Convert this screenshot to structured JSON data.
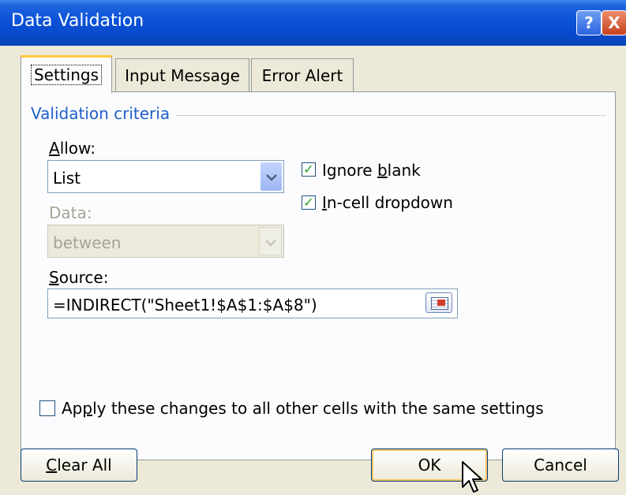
{
  "window": {
    "title": "Data Validation"
  },
  "titlebar_buttons": {
    "help": "?",
    "close": "X"
  },
  "tabs": [
    {
      "label": "Settings",
      "selected": true
    },
    {
      "label": "Input Message",
      "selected": false
    },
    {
      "label": "Error Alert",
      "selected": false
    }
  ],
  "group": {
    "title": "Validation criteria"
  },
  "allow": {
    "label_prefix": "",
    "label_access": "A",
    "label_rest": "llow:",
    "value": "List"
  },
  "data": {
    "label": "Data:",
    "value": "between"
  },
  "source": {
    "label_access": "S",
    "label_rest": "ource:",
    "value": "=INDIRECT(\"Sheet1!$A$1:$A$8\")"
  },
  "checkboxes": {
    "ignore_blank": {
      "prefix": "Ignore ",
      "access": "b",
      "rest": "lank",
      "checked": true
    },
    "incell_dropdown": {
      "prefix": "",
      "access": "I",
      "rest": "n-cell dropdown",
      "checked": true
    },
    "apply_all": {
      "prefix": "Ap",
      "access": "p",
      "rest": "ly these changes to all other cells with the same settings",
      "checked": false
    }
  },
  "buttons": {
    "clear_all": {
      "access": "C",
      "rest": "lear All"
    },
    "ok": "OK",
    "cancel": "Cancel"
  },
  "icons": {
    "dropdown_arrow": "chevron-down-icon",
    "check": "checkmark-icon",
    "collapse": "range-collapse-icon",
    "cursor": "mouse-pointer-icon"
  },
  "colors": {
    "titlebar": "#0a52d8",
    "group_title": "#1e5fc8",
    "tab_highlight": "#ffc83c",
    "check": "#21a121"
  }
}
